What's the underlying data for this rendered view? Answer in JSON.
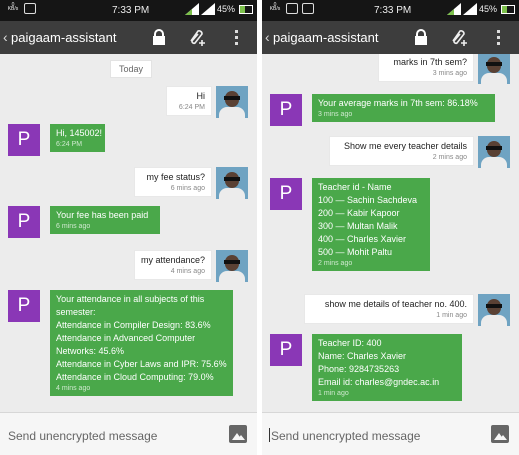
{
  "status_bar": {
    "time": "7:33 PM",
    "battery": "45%",
    "net_label": "0 KB/s",
    "battery_level": 0.45
  },
  "app_bar": {
    "back_glyph": "‹",
    "title": "paigaam-assistant",
    "icons": [
      "lock-icon",
      "attach-add-icon",
      "more-vert-icon"
    ]
  },
  "composer": {
    "placeholder": "Send unencrypted message",
    "icon": "image-icon"
  },
  "colors": {
    "incoming_bubble": "#4aa84a",
    "bot_avatar": "#8a37b6",
    "app_bar": "#3d3d3d",
    "status_bar": "#151515",
    "chat_bg": "#ececec"
  },
  "bot_initial": "P",
  "left": {
    "day": "Today",
    "messages": [
      {
        "dir": "out",
        "lines": [
          "Hi"
        ],
        "time": "6:24 PM"
      },
      {
        "dir": "in",
        "lines": [
          "Hi, 145002!"
        ],
        "time": "6:24 PM"
      },
      {
        "dir": "out",
        "lines": [
          "my fee status?"
        ],
        "time": "6 mins ago"
      },
      {
        "dir": "in",
        "lines": [
          "Your fee has been paid"
        ],
        "time": "6 mins ago"
      },
      {
        "dir": "out",
        "lines": [
          "my attendance?"
        ],
        "time": "4 mins ago"
      },
      {
        "dir": "in",
        "lines": [
          "Your attendance in all subjects of this",
          "semester:",
          "Attendance in Compiler Design: 83.6%",
          "Attendance in Advanced Computer",
          "Networks: 45.6%",
          "Attendance in Cyber Laws and IPR: 75.6%",
          "Attendance in Cloud Computing: 79.0%"
        ],
        "time": "4 mins ago"
      }
    ]
  },
  "right": {
    "messages": [
      {
        "dir": "out",
        "lines": [
          "marks in 7th sem?"
        ],
        "time": "3 mins ago"
      },
      {
        "dir": "in",
        "lines": [
          "Your average marks in 7th sem: 86.18%"
        ],
        "time": "3 mins ago"
      },
      {
        "dir": "out",
        "lines": [
          "Show me every teacher details"
        ],
        "time": "2 mins ago"
      },
      {
        "dir": "in",
        "lines": [
          "Teacher id - Name",
          "100  —  Sachin Sachdeva",
          "200  —  Kabir Kapoor",
          "300  —  Multan Malik",
          "400  —  Charles Xavier",
          "500  —  Mohit Paltu"
        ],
        "time": "2 mins ago"
      },
      {
        "dir": "out",
        "lines": [
          "show me details of teacher no. 400."
        ],
        "time": "1 min ago"
      },
      {
        "dir": "in",
        "lines": [
          "Teacher ID: 400",
          "Name: Charles Xavier",
          "Phone: 9284735263",
          "Email id: charles@gndec.ac.in"
        ],
        "time": "1 min ago"
      }
    ]
  }
}
